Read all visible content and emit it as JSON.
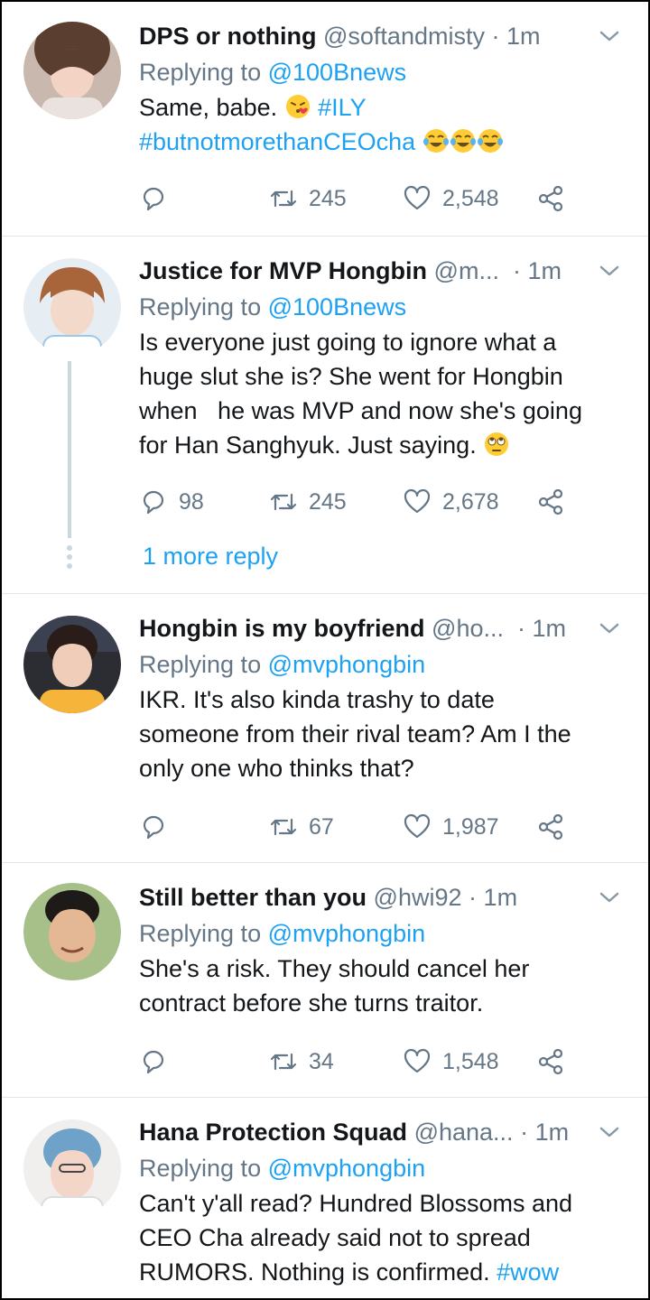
{
  "tweets": [
    {
      "name": "DPS or nothing",
      "handle": "@softandmisty",
      "time": "1m",
      "replying_prefix": "Replying to",
      "replying_to": "@100Bnews",
      "text_lines": [
        "Same, babe.",
        "#ILY",
        "#butnotmorethanCEOcha"
      ],
      "reply_count": "",
      "retweet_count": "245",
      "like_count": "2,548"
    },
    {
      "name": "Justice for MVP Hongbin",
      "handle": "@m...",
      "time": "1m",
      "replying_prefix": "Replying to",
      "replying_to": "@100Bnews",
      "text_lines": [
        "Is everyone just going to ignore what a",
        "huge slut she is? She went for Hongbin",
        "when   he was MVP and now she's going",
        "for Han Sanghyuk. Just saying."
      ],
      "reply_count": "98",
      "retweet_count": "245",
      "like_count": "2,678",
      "more_reply": "1 more reply"
    },
    {
      "name": "Hongbin is my boyfriend",
      "handle": "@ho...",
      "time": "1m",
      "replying_prefix": "Replying to",
      "replying_to": "@mvphongbin",
      "text_lines": [
        "IKR. It's also kinda trashy to date",
        "someone from their rival team? Am I the",
        "only one who thinks that?"
      ],
      "reply_count": "",
      "retweet_count": "67",
      "like_count": "1,987"
    },
    {
      "name": "Still better than you",
      "handle": "@hwi92",
      "time": "1m",
      "replying_prefix": "Replying to",
      "replying_to": "@mvphongbin",
      "text_lines": [
        "She's a risk. They should cancel her",
        "contract before she turns traitor."
      ],
      "reply_count": "",
      "retweet_count": "34",
      "like_count": "1,548"
    },
    {
      "name": "Hana Protection Squad",
      "handle": "@hana...",
      "time": "1m",
      "replying_prefix": "Replying to",
      "replying_to": "@mvphongbin",
      "text_lines": [
        "Can't y'all read? Hundred Blossoms and",
        "CEO Cha already said not to spread",
        "RUMORS. Nothing is confirmed."
      ],
      "hashtag": "#wow"
    }
  ],
  "icons": {
    "reply": "reply-icon",
    "retweet": "retweet-icon",
    "like": "heart-icon",
    "share": "share-icon",
    "caret": "chevron-down-icon"
  },
  "colors": {
    "link": "#1da1f2",
    "muted": "#657786",
    "divider": "#dfe5ea"
  }
}
